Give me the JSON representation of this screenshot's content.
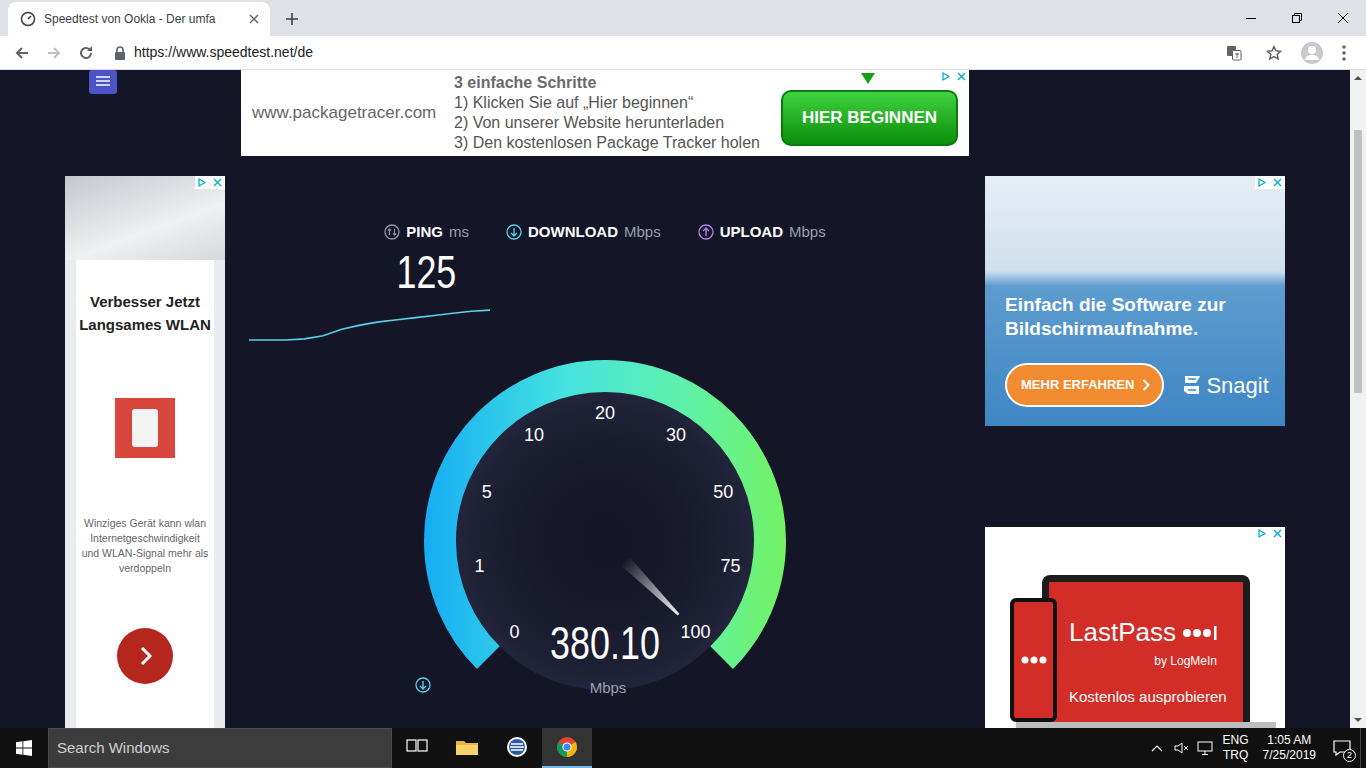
{
  "browser": {
    "tabs": [
      {
        "label": "Speedtest von Ookla - Der umfa",
        "selected": true
      }
    ],
    "address": "https://www.speedtest.net/de"
  },
  "page": {
    "top_ad": {
      "url": "www.packagetracer.com",
      "heading": "3 einfache Schritte",
      "steps": [
        "1) Klicken Sie auf „Hier beginnen“",
        "2) Von unserer Website herunterladen",
        "3) Den kostenlosen Package Tracker holen"
      ],
      "button": "HIER BEGINNEN"
    },
    "left_ad": {
      "title": "Verbesser Jetzt Langsames WLAN",
      "text": "Winziges Gerät kann wlan Internetgeschwindigkeit und WLAN-Signal mehr als verdoppeln"
    },
    "right_ad": {
      "text": "Einfach die Software zur Bildschirmaufnahme.",
      "button": "MEHR ERFAHREN",
      "brand": "Snagit"
    },
    "lastpass_ad": {
      "brand": "LastPass",
      "byline": "by LogMeIn",
      "text": "Kostenlos ausprobieren"
    },
    "speedtest": {
      "metrics": [
        {
          "kind": "ping",
          "label": "PING",
          "unit": "ms",
          "value": "125"
        },
        {
          "kind": "download",
          "label": "DOWNLOAD",
          "unit": "Mbps"
        },
        {
          "kind": "upload",
          "label": "UPLOAD",
          "unit": "Mbps"
        }
      ],
      "graph": {
        "values": [
          0,
          0,
          0,
          1,
          4,
          10,
          14,
          17,
          19,
          21,
          23,
          25,
          27,
          28
        ]
      },
      "gauge": {
        "ticks": [
          "0",
          "1",
          "5",
          "10",
          "20",
          "30",
          "50",
          "75",
          "100"
        ],
        "level": 1,
        "reading": "380.10",
        "unit": "Mbps"
      }
    }
  },
  "taskbar": {
    "search": {
      "placeholder": "Search Windows"
    },
    "apps": [
      {
        "kind": "task-view",
        "selected": false
      },
      {
        "kind": "explorer",
        "selected": false
      },
      {
        "kind": "app",
        "selected": false
      },
      {
        "kind": "chrome",
        "selected": true
      }
    ],
    "muted": true,
    "language": "ENG",
    "keyboard": "TRQ",
    "time": "1:05 AM",
    "date": "7/25/2019",
    "notifications": "2"
  }
}
